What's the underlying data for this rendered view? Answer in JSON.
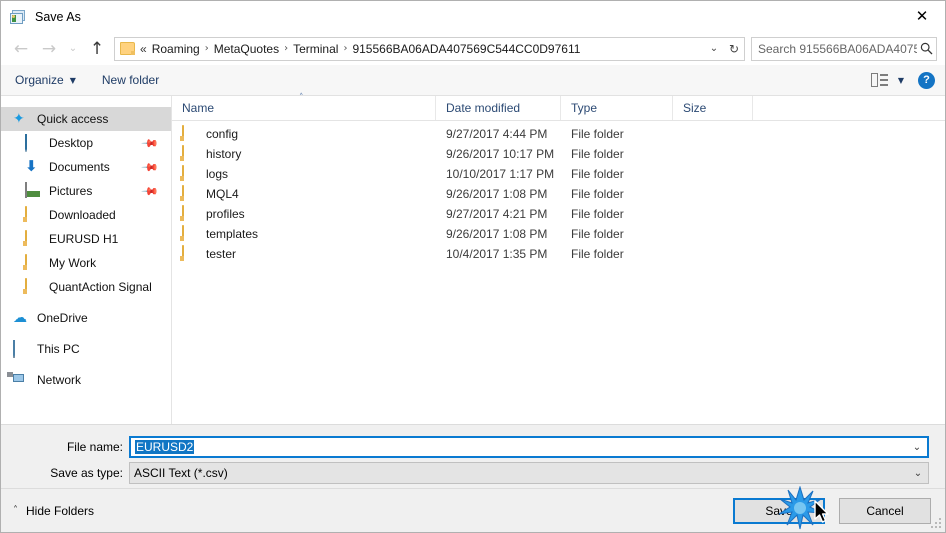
{
  "window": {
    "title": "Save As",
    "app_icon": "save-as-window-icon",
    "close_label": "✕"
  },
  "nav": {
    "back": "←",
    "forward": "→",
    "recent": "⌄",
    "up": "↑",
    "breadcrumb_prefix": "«",
    "breadcrumb": [
      "Roaming",
      "MetaQuotes",
      "Terminal",
      "915566BA06ADA407569C544CC0D97611"
    ],
    "breadcrumb_separator": "›",
    "dropdown_caret": "⌄",
    "refresh": "↻"
  },
  "search": {
    "placeholder": "Search 915566BA06ADA40756...",
    "icon": "🔍"
  },
  "toolbar": {
    "organize_label": "Organize",
    "organize_caret": "▼",
    "new_folder_label": "New folder",
    "view_caret": "▼",
    "help_label": "?"
  },
  "sidebar": {
    "items": [
      {
        "label": "Quick access",
        "icon": "star-icon",
        "level": "root",
        "selected": true,
        "pinned": false
      },
      {
        "label": "Desktop",
        "icon": "desktop-icon",
        "level": "child",
        "selected": false,
        "pinned": true
      },
      {
        "label": "Documents",
        "icon": "documents-icon",
        "level": "child",
        "selected": false,
        "pinned": true
      },
      {
        "label": "Pictures",
        "icon": "pictures-icon",
        "level": "child",
        "selected": false,
        "pinned": true
      },
      {
        "label": "Downloaded",
        "icon": "folder-icon",
        "level": "child",
        "selected": false,
        "pinned": false
      },
      {
        "label": "EURUSD H1",
        "icon": "folder-icon",
        "level": "child",
        "selected": false,
        "pinned": false
      },
      {
        "label": "My Work",
        "icon": "folder-icon",
        "level": "child",
        "selected": false,
        "pinned": false
      },
      {
        "label": "QuantAction Signal",
        "icon": "folder-icon",
        "level": "child",
        "selected": false,
        "pinned": false
      },
      {
        "label": "OneDrive",
        "icon": "onedrive-icon",
        "level": "root",
        "selected": false,
        "pinned": false
      },
      {
        "label": "This PC",
        "icon": "this-pc-icon",
        "level": "root",
        "selected": false,
        "pinned": false
      },
      {
        "label": "Network",
        "icon": "network-icon",
        "level": "root",
        "selected": false,
        "pinned": false
      }
    ],
    "pin_glyph": "✒"
  },
  "filelist": {
    "columns": [
      "Name",
      "Date modified",
      "Type",
      "Size"
    ],
    "sort_caret": "˄",
    "rows": [
      {
        "name": "config",
        "date": "9/27/2017 4:44 PM",
        "type": "File folder",
        "size": ""
      },
      {
        "name": "history",
        "date": "9/26/2017 10:17 PM",
        "type": "File folder",
        "size": ""
      },
      {
        "name": "logs",
        "date": "10/10/2017 1:17 PM",
        "type": "File folder",
        "size": ""
      },
      {
        "name": "MQL4",
        "date": "9/26/2017 1:08 PM",
        "type": "File folder",
        "size": ""
      },
      {
        "name": "profiles",
        "date": "9/27/2017 4:21 PM",
        "type": "File folder",
        "size": ""
      },
      {
        "name": "templates",
        "date": "9/26/2017 1:08 PM",
        "type": "File folder",
        "size": ""
      },
      {
        "name": "tester",
        "date": "10/4/2017 1:35 PM",
        "type": "File folder",
        "size": ""
      }
    ]
  },
  "form": {
    "file_name_label": "File name:",
    "file_name_value": "EURUSD2",
    "save_as_type_label": "Save as type:",
    "save_as_type_value": "ASCII Text (*.csv)",
    "combo_arrow": "⌄"
  },
  "footer": {
    "hide_folders_label": "Hide Folders",
    "hide_folders_caret": "˄",
    "save_label": "Save",
    "cancel_label": "Cancel"
  },
  "colors": {
    "accent": "#0a7ad1",
    "selection": "#1176c4",
    "folder": "#ffd782",
    "link_text": "#1f3c66",
    "header_text": "#2c4a74",
    "sidebar_selected": "#d8d8d8"
  }
}
